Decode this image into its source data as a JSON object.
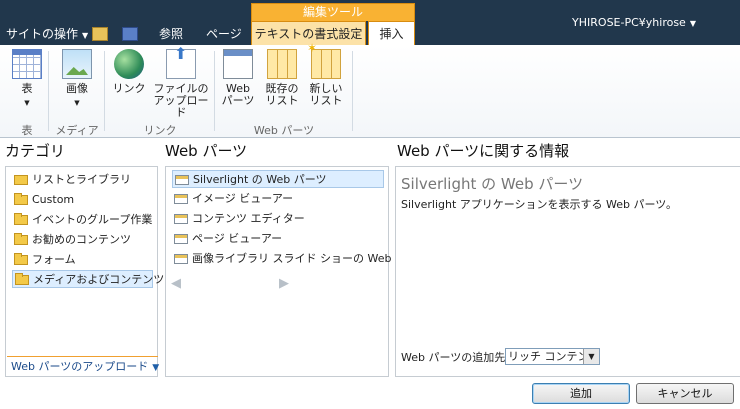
{
  "topbar": {
    "site_actions": "サイトの操作",
    "tab_browse": "参照",
    "tab_page": "ページ",
    "context_group": "編集ツール",
    "tab_format_text": "テキストの書式設定",
    "tab_insert": "挿入",
    "user": "YHIROSE-PC¥yhirose",
    "icons": [
      "folder-up-icon",
      "edit-page-icon"
    ]
  },
  "ribbon": {
    "buttons": [
      {
        "label": "表",
        "icon": "table-icon"
      },
      {
        "label": "画像",
        "icon": "image-icon"
      },
      {
        "label": "リンク",
        "icon": "link-icon"
      },
      {
        "label1": "ファイルの",
        "label2": "アップロード",
        "icon": "upload-file-icon"
      },
      {
        "label1": "Web",
        "label2": "パーツ",
        "icon": "web-part-icon"
      },
      {
        "label1": "既存の",
        "label2": "リスト",
        "icon": "existing-list-icon"
      },
      {
        "label1": "新しい",
        "label2": "リスト",
        "icon": "new-list-icon"
      }
    ],
    "groups": [
      "表",
      "メディア",
      "リンク",
      "Web パーツ"
    ]
  },
  "categories": {
    "title": "カテゴリ",
    "items": [
      "リストとライブラリ",
      "Custom",
      "イベントのグループ作業",
      "お勧めのコンテンツ",
      "フォーム",
      "メディアおよびコンテンツ"
    ],
    "upload_label": "Web パーツのアップロード"
  },
  "webparts": {
    "title": "Web パーツ",
    "items": [
      "Silverlight の Web パーツ",
      "イメージ ビューアー",
      "コンテンツ エディター",
      "ページ ビューアー",
      "画像ライブラリ スライド ショーの Web ..."
    ],
    "prev": "◆",
    "next": "◆"
  },
  "info": {
    "title": "Web パーツに関する情報",
    "selected_name": "Silverlight の Web パーツ",
    "description": "Silverlight アプリケーションを表示する Web パーツ。",
    "add_to_label": "Web パーツの追加先:",
    "add_to_value": "リッチ コンテンツ"
  },
  "buttons": {
    "add": "追加",
    "cancel": "キャンセル"
  }
}
